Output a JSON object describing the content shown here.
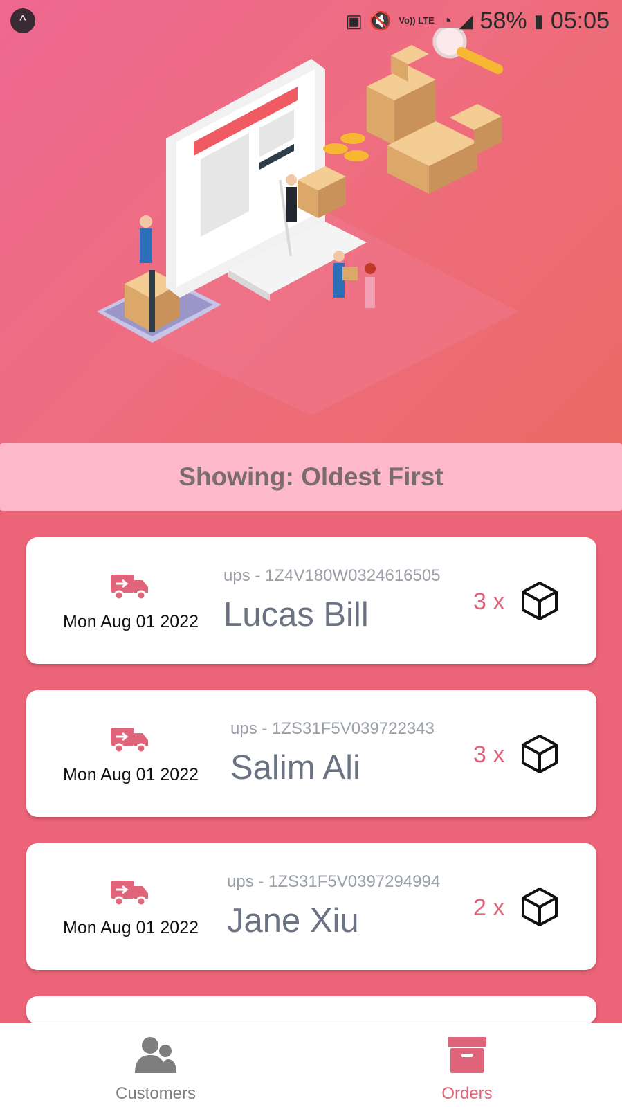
{
  "status_bar": {
    "battery_percent": "58%",
    "time": "05:05",
    "network": "Vo)) LTE"
  },
  "sort_bar": {
    "label": "Showing: Oldest First"
  },
  "orders": [
    {
      "date": "Mon Aug 01 2022",
      "tracking": "ups - 1Z4V180W0324616505",
      "name": "Lucas Bill",
      "quantity": "3 x"
    },
    {
      "date": "Mon Aug 01 2022",
      "tracking": "ups - 1ZS31F5V039722343",
      "name": "Salim Ali",
      "quantity": "3 x"
    },
    {
      "date": "Mon Aug 01 2022",
      "tracking": "ups - 1ZS31F5V0397294994",
      "name": "Jane Xiu",
      "quantity": "2 x"
    }
  ],
  "bottom_nav": {
    "customers_label": "Customers",
    "orders_label": "Orders"
  },
  "colors": {
    "accent": "#e0657a",
    "background": "#ec6478",
    "sort_bar": "#fdb8c9"
  }
}
